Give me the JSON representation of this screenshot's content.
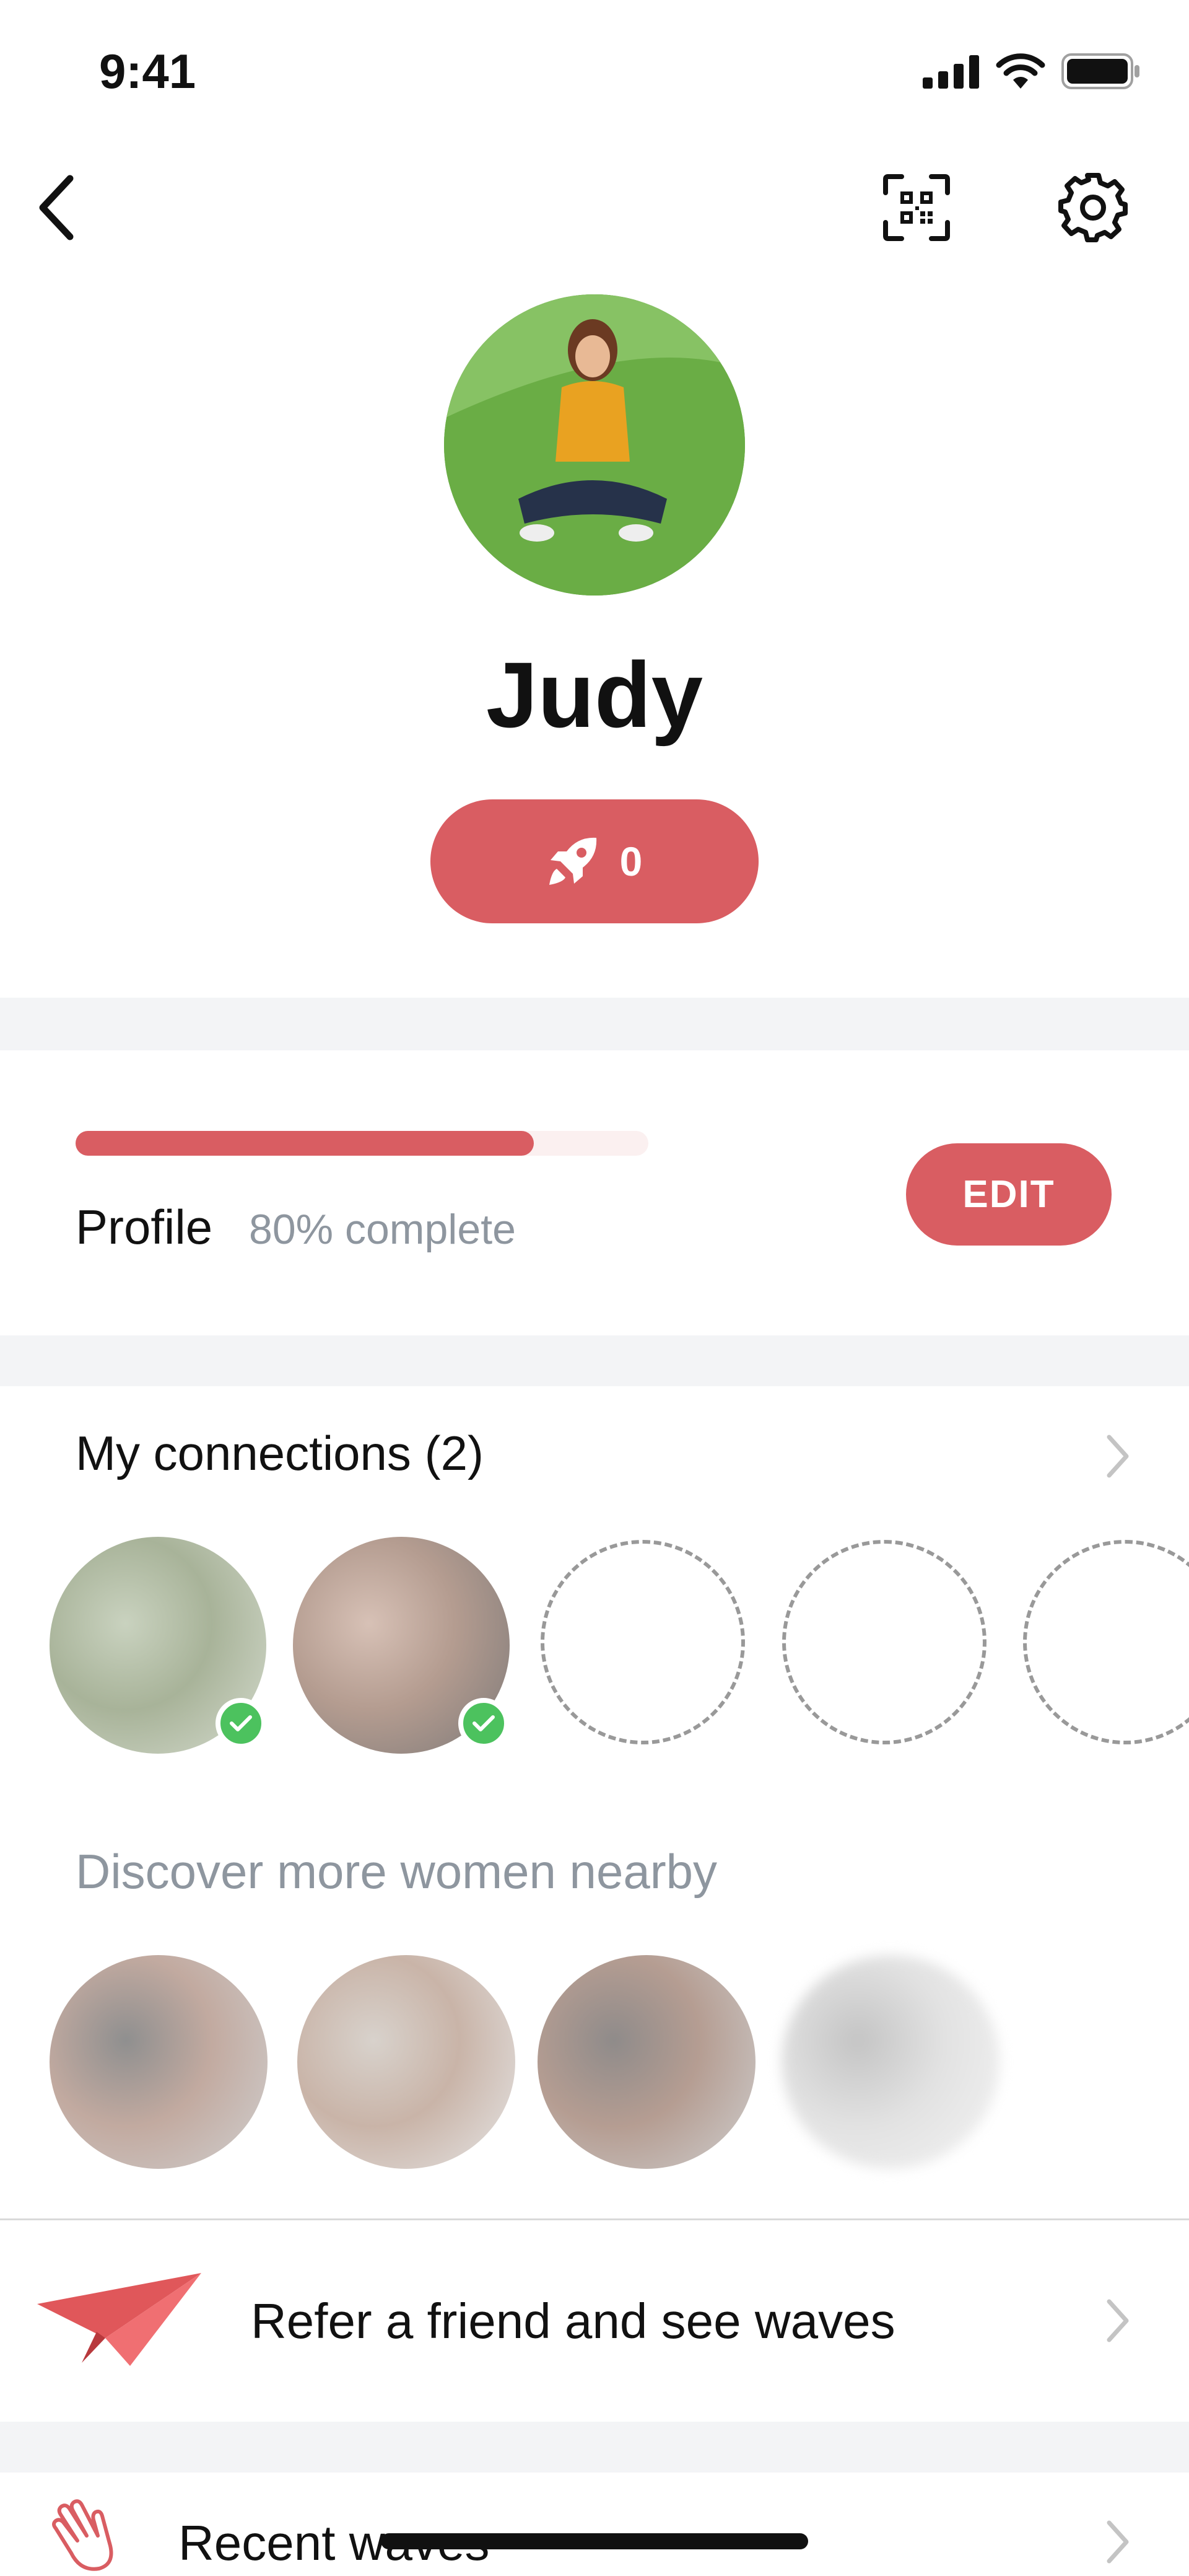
{
  "status_bar": {
    "time": "9:41"
  },
  "nav": {
    "back_icon": "chevron-left-icon",
    "qr_icon": "qr-code-scan-icon",
    "settings_icon": "gear-icon"
  },
  "profile": {
    "name": "Judy",
    "boost_count": "0",
    "boost_icon": "rocket-icon",
    "completion_label": "Profile",
    "completion_status": "80% complete",
    "completion_fraction": 0.8,
    "edit_label": "EDIT"
  },
  "connections": {
    "title": "My connections (2)",
    "items": [
      {
        "verified": true,
        "avatar_colors": [
          "#c9d2bf",
          "#a8b399",
          "#d6dccf"
        ]
      },
      {
        "verified": true,
        "avatar_colors": [
          "#d7c1b6",
          "#b49c90",
          "#7d7978"
        ]
      }
    ],
    "empty_slots": 3
  },
  "discover": {
    "title": "Discover more women nearby",
    "items": [
      {
        "avatar_colors": [
          "#8f8f8f",
          "#c2aaa0",
          "#d0d0d0"
        ]
      },
      {
        "avatar_colors": [
          "#d8d2cc",
          "#c9b4a8",
          "#e6e6e6"
        ]
      },
      {
        "avatar_colors": [
          "#8f8b8a",
          "#b59d92",
          "#cfcfcf"
        ]
      },
      {
        "avatar_colors": [
          "#c4c4c4",
          "#e2e2e2",
          "#f4f4f4"
        ]
      }
    ]
  },
  "refer": {
    "label": "Refer a friend and see waves",
    "icon": "paper-plane-icon"
  },
  "waves": {
    "label": "Recent waves",
    "icon": "waving-hand-icon"
  },
  "colors": {
    "accent": "#d95d62",
    "muted_text": "#8e969f",
    "verified_green": "#4cc25e",
    "section_gray": "#f3f4f6"
  }
}
